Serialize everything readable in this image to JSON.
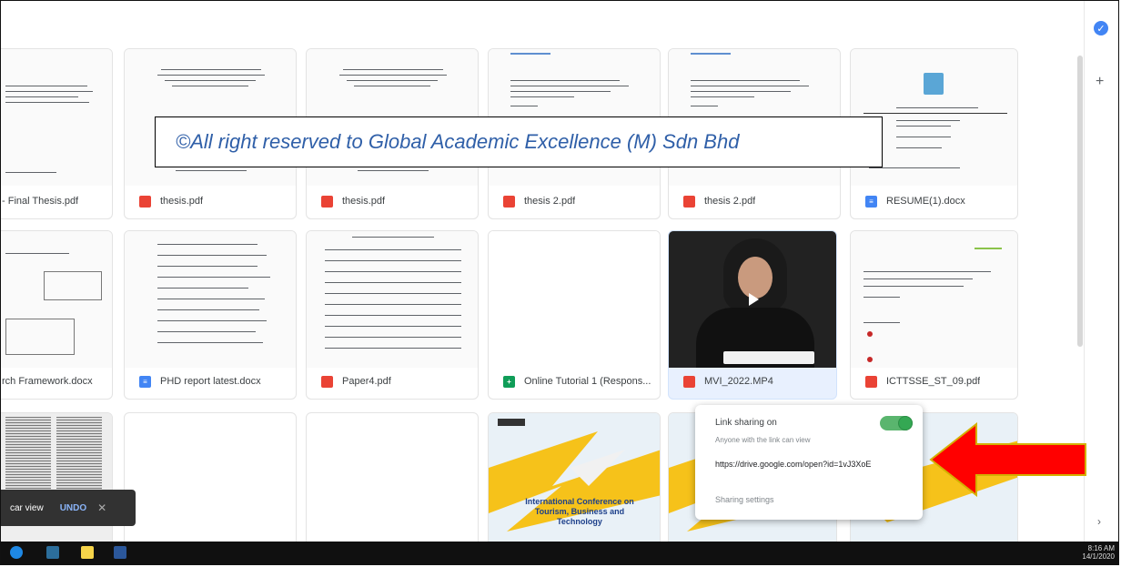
{
  "watermark": "©All right reserved to Global Academic Excellence (M) Sdn Bhd",
  "files_row1": [
    {
      "name": "- Final Thesis.pdf",
      "type": "pdf"
    },
    {
      "name": "thesis.pdf",
      "type": "pdf"
    },
    {
      "name": "thesis.pdf",
      "type": "pdf"
    },
    {
      "name": "thesis 2.pdf",
      "type": "pdf"
    },
    {
      "name": "thesis 2.pdf",
      "type": "pdf"
    },
    {
      "name": "RESUME(1).docx",
      "type": "doc"
    }
  ],
  "files_row2": [
    {
      "name": "rch Framework.docx",
      "type": "doc"
    },
    {
      "name": "PHD report latest.docx",
      "type": "doc"
    },
    {
      "name": "Paper4.pdf",
      "type": "pdf"
    },
    {
      "name": "Online Tutorial 1 (Respons...",
      "type": "sheet"
    },
    {
      "name": "MVI_2022.MP4",
      "type": "video"
    },
    {
      "name": "ICTTSSE_ST_09.pdf",
      "type": "pdf"
    }
  ],
  "conference_card_text": "International Conference on Tourism, Business and Technology",
  "snackbar": {
    "text": "car view",
    "undo_label": "UNDO",
    "close_glyph": "✕"
  },
  "share_popup": {
    "title": "Link sharing on",
    "subtitle": "Anyone with the link can view",
    "link": "https://drive.google.com/open?id=1vJ3XoE",
    "settings_label": "Sharing settings",
    "toggle_on": true
  },
  "rightbar": {
    "icon1": "check-circle-icon",
    "add_glyph": "+",
    "bottom_glyph": "›"
  },
  "taskbar": {
    "time": "8:16 AM",
    "date": "14/1/2020"
  },
  "colors": {
    "watermark_text": "#2f5fa8",
    "arrow": "#ff0000",
    "arrow_border": "#d4b000",
    "toggle": "#34a853"
  }
}
